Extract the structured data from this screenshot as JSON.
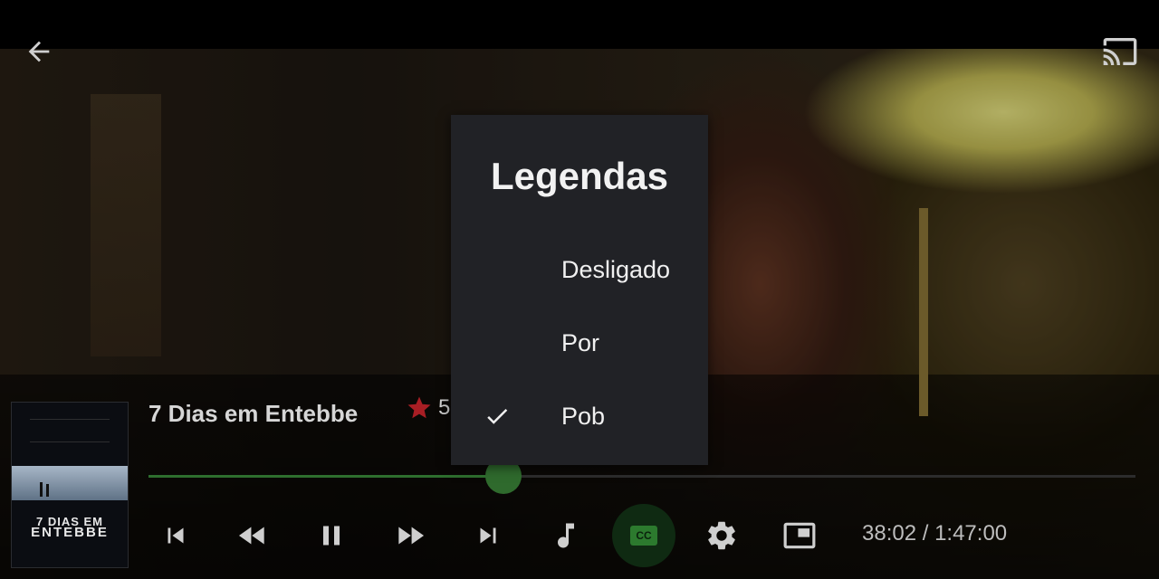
{
  "movie": {
    "title": "7 Dias em Entebbe",
    "rating": "5."
  },
  "poster": {
    "title_line1": "7 DIAS EM",
    "title_line2": "ENTEBBE"
  },
  "playback": {
    "time": "38:02 / 1:47:00",
    "progress": 0.36
  },
  "subtitles_dialog": {
    "title": "Legendas",
    "options": [
      {
        "label": "Desligado",
        "selected": false
      },
      {
        "label": "Por",
        "selected": false
      },
      {
        "label": "Pob",
        "selected": true
      }
    ]
  },
  "icons": {
    "back": "arrow-left-icon",
    "cast": "cast-icon",
    "skip_previous": "skip-previous-icon",
    "rewind": "rewind-icon",
    "pause": "pause-icon",
    "fast_forward": "fast-forward-icon",
    "skip_next": "skip-next-icon",
    "audio": "music-note-icon",
    "captions": "closed-captions-icon",
    "settings": "gear-icon",
    "pip": "picture-in-picture-icon",
    "rating_star": "star-icon",
    "check": "check-icon"
  },
  "colors": {
    "accent_green": "#2f6a2d",
    "star_red": "#a81e24",
    "dialog_bg": "#212226",
    "cc_green": "#2c7a2e"
  }
}
